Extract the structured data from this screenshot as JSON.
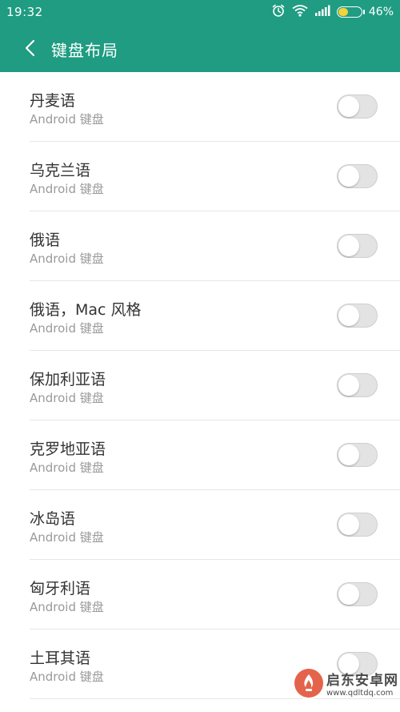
{
  "status_bar": {
    "time": "19:32",
    "battery_text": "46%",
    "battery_level": 0.46,
    "icons": [
      "alarm-icon",
      "wifi-icon",
      "signal-icon",
      "battery-icon"
    ]
  },
  "header": {
    "title": "键盘布局",
    "back_icon": "back-chevron-icon"
  },
  "layouts": [
    {
      "title": "丹麦语",
      "subtitle": "Android 键盘",
      "enabled": false
    },
    {
      "title": "乌克兰语",
      "subtitle": "Android 键盘",
      "enabled": false
    },
    {
      "title": "俄语",
      "subtitle": "Android 键盘",
      "enabled": false
    },
    {
      "title": "俄语，Mac 风格",
      "subtitle": "Android 键盘",
      "enabled": false
    },
    {
      "title": "保加利亚语",
      "subtitle": "Android 键盘",
      "enabled": false
    },
    {
      "title": "克罗地亚语",
      "subtitle": "Android 键盘",
      "enabled": false
    },
    {
      "title": "冰岛语",
      "subtitle": "Android 键盘",
      "enabled": false
    },
    {
      "title": "匈牙利语",
      "subtitle": "Android 键盘",
      "enabled": false
    },
    {
      "title": "土耳其语",
      "subtitle": "Android 键盘",
      "enabled": false
    }
  ],
  "watermark": {
    "title": "启东安卓网",
    "url": "www.qdltdq.com"
  },
  "colors": {
    "accent": "#1f9c82",
    "switch_off": "#e3e3e3",
    "battery": "#f5d23a"
  }
}
